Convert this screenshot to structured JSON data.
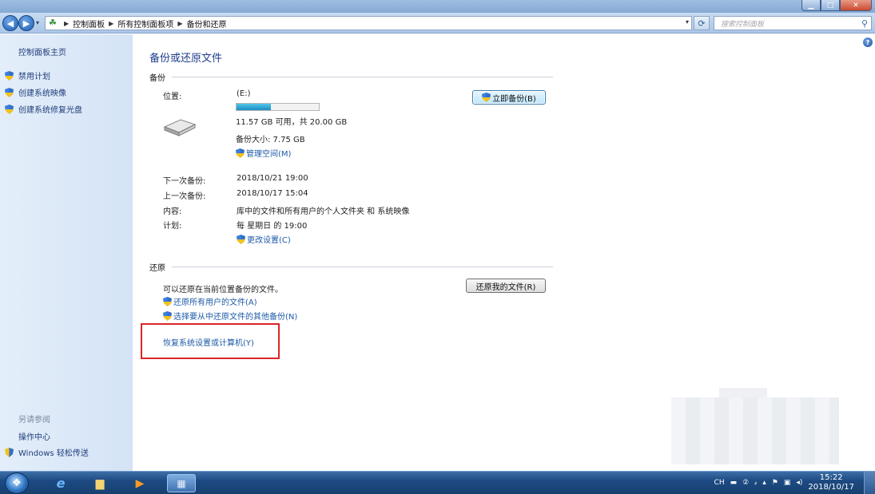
{
  "window": {
    "controls": {
      "minimize": "▁",
      "maximize": "□",
      "close": "✕"
    }
  },
  "address": {
    "breadcrumbs": [
      "控制面板",
      "所有控制面板项",
      "备份和还原"
    ],
    "search_placeholder": "搜索控制面板",
    "accent_color": "#1e3d8a"
  },
  "sidebar": {
    "home": "控制面板主页",
    "tasks": [
      "禁用计划",
      "创建系统映像",
      "创建系统修复光盘"
    ],
    "see_also_title": "另请参阅",
    "see_also": [
      "操作中心",
      "Windows 轻松传送"
    ]
  },
  "main": {
    "title": "备份或还原文件",
    "backup": {
      "section_title": "备份",
      "location_label": "位置:",
      "location_value": "(E:)",
      "disk_used_fraction": 0.42,
      "disk_free": "11.57 GB 可用，共 20.00 GB",
      "backup_size": "备份大小: 7.75 GB",
      "manage_space_link": "管理空间(M)",
      "backup_now_button": "立即备份(B)",
      "next_backup_label": "下一次备份:",
      "next_backup_value": "2018/10/21 19:00",
      "last_backup_label": "上一次备份:",
      "last_backup_value": "2018/10/17 15:04",
      "contents_label": "内容:",
      "contents_value": "库中的文件和所有用户的个人文件夹 和 系统映像",
      "schedule_label": "计划:",
      "schedule_value": "每 星期日 的 19:00",
      "change_settings_link": "更改设置(C)"
    },
    "restore": {
      "section_title": "还原",
      "description": "可以还原在当前位置备份的文件。",
      "restore_my_files_button": "还原我的文件(R)",
      "restore_all_users_link": "还原所有用户的文件(A)",
      "select_other_backup_link": "选择要从中还原文件的其他备份(N)",
      "recover_system_link": "恢复系统设置或计算机(Y)",
      "highlight_color": "#d9252a"
    }
  },
  "taskbar": {
    "start_icon": "windows-start-orb",
    "apps": [
      "ie-icon",
      "explorer-icon",
      "media-player-icon",
      "control-panel-icon"
    ],
    "tray": {
      "language": "CH",
      "time": "15:22",
      "date": "2018/10/17"
    }
  }
}
